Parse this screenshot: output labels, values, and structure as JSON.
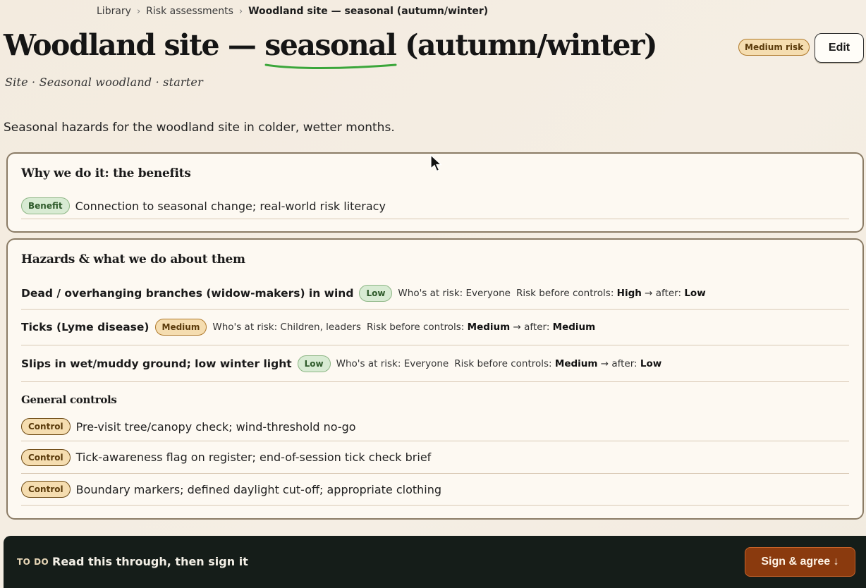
{
  "breadcrumb": {
    "items": [
      "Library",
      "Risk assessments"
    ],
    "current": "Woodland site — seasonal (autumn/winter)"
  },
  "page": {
    "title_prefix": "Woodland site — ",
    "title_highlight": "seasonal",
    "title_suffix": " (autumn/winter)",
    "subtitle": "Site · Seasonal woodland · starter",
    "risk_badge": "Medium risk",
    "edit_label": "Edit",
    "summary": "Seasonal hazards for the woodland site in colder, wetter months.",
    "highlight_color": "#3aa63a"
  },
  "benefits": {
    "heading": "Why we do it: the benefits",
    "items": [
      {
        "tag": "Benefit",
        "text": "Connection to seasonal change; real-world risk literacy"
      }
    ]
  },
  "hazards": {
    "heading": "Hazards & what we do about them",
    "who_label": "Who's at risk:",
    "before_label": "Risk before controls:",
    "after_label": "→ after:",
    "items": [
      {
        "name": "Dead / overhanging branches (widow-makers) in wind",
        "level": "Low",
        "who": "Everyone",
        "before": "High",
        "after": "Low"
      },
      {
        "name": "Ticks (Lyme disease)",
        "level": "Medium",
        "who": "Children, leaders",
        "before": "Medium",
        "after": "Medium"
      },
      {
        "name": "Slips in wet/muddy ground; low winter light",
        "level": "Low",
        "who": "Everyone",
        "before": "Medium",
        "after": "Low"
      }
    ],
    "general_heading": "General controls",
    "controls": [
      {
        "tag": "Control",
        "text": "Pre-visit tree/canopy check; wind-threshold no-go"
      },
      {
        "tag": "Control",
        "text": "Tick-awareness flag on register; end-of-session tick check brief"
      },
      {
        "tag": "Control",
        "text": "Boundary markers; defined daylight cut-off; appropriate clothing"
      }
    ]
  },
  "todo": {
    "tag": "TO DO",
    "text": "Read this through, then sign it",
    "button": "Sign & agree ↓"
  }
}
